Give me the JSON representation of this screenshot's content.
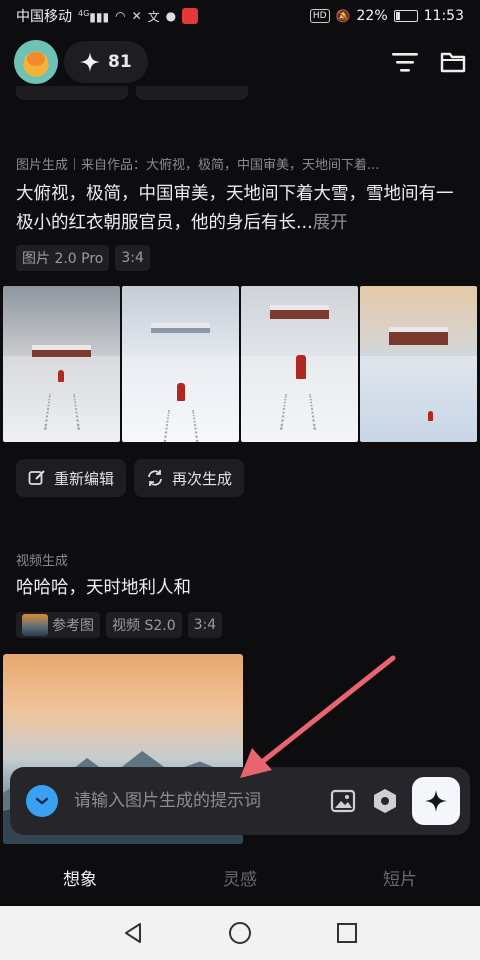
{
  "status_bar": {
    "carrier": "中国移动",
    "network": "4G",
    "battery": "22%",
    "time": "11:53",
    "hd": "HD"
  },
  "header": {
    "credits": "81"
  },
  "feed": {
    "image_card": {
      "type_label": "图片生成",
      "source": "来自作品：大俯视，极简，中国审美，天地间下着...",
      "prompt": "大俯视，极简，中国审美，天地间下着大雪，雪地间有一极小的红衣朝服官员，他的身后有长...",
      "expand": "展开",
      "tags": [
        "图片 2.0 Pro",
        "3:4"
      ],
      "actions": [
        "重新编辑",
        "再次生成"
      ]
    },
    "video_card": {
      "type_label": "视频生成",
      "prompt": "哈哈哈，天时地利人和",
      "tags": [
        "参考图",
        "视频 S2.0",
        "3:4"
      ]
    }
  },
  "input": {
    "placeholder": "请输入图片生成的提示词"
  },
  "tabs": [
    {
      "label": "想象",
      "active": true
    },
    {
      "label": "灵感",
      "active": false
    },
    {
      "label": "短片",
      "active": false
    }
  ],
  "colors": {
    "background": "#0d0d10",
    "accent_blue": "#3aa0f2",
    "arrow": "#e8646f"
  }
}
